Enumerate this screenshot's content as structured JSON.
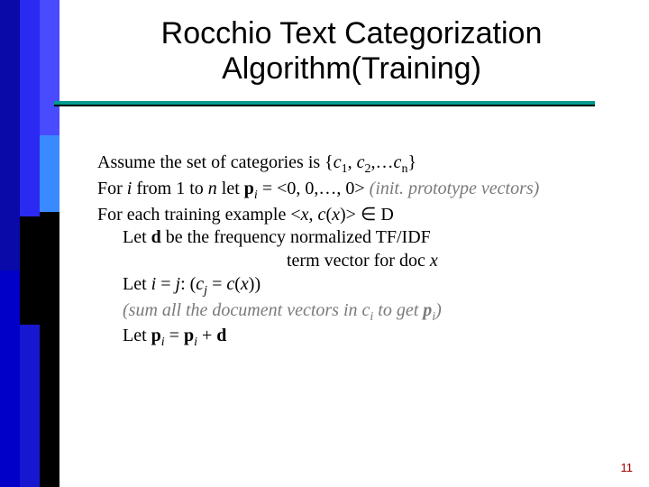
{
  "title": "Rocchio Text Categorization Algorithm(Training)",
  "lines": {
    "l1a": "Assume the set of categories is {",
    "l1c1": "c",
    "l1s1": "1",
    "l1sep1": ", ",
    "l1c2": "c",
    "l1s2": "2",
    "l1sep2": ",…",
    "l1c3": "c",
    "l1s3": "n",
    "l1b": "}",
    "l2a": "For ",
    "l2i": "i",
    "l2b": " from 1 to ",
    "l2n": "n",
    "l2c": " let ",
    "l2p": "p",
    "l2ps": "i",
    "l2d": " = <0, 0,…, 0>  ",
    "l2comment": "(init. prototype vectors)",
    "l3a": "For each training example <",
    "l3x": "x",
    "l3b": ", ",
    "l3c": "c",
    "l3d": "(",
    "l3x2": "x",
    "l3e": ")> ∈ D",
    "l4a": "Let ",
    "l4d": "d",
    "l4b": " be the frequency normalized TF/IDF",
    "l5": "term vector for doc ",
    "l5x": "x",
    "l6a": "Let ",
    "l6i": "i",
    "l6b": " =  ",
    "l6j": "j",
    "l6c": ": (",
    "l6cj": "c",
    "l6cjs": "j",
    "l6d": " = ",
    "l6cf": "c",
    "l6e": "(",
    "l6x": "x",
    "l6f": "))",
    "l7a": "(sum all the document vectors in ",
    "l7c": "c",
    "l7cs": "i",
    "l7b": " to get ",
    "l7p": "p",
    "l7ps": "i",
    "l7d": ")",
    "l8a": "Let ",
    "l8p1": "p",
    "l8p1s": "i",
    "l8b": " = ",
    "l8p2": "p",
    "l8p2s": "i",
    "l8c": " + ",
    "l8d2": "d"
  },
  "pagenum": "11"
}
